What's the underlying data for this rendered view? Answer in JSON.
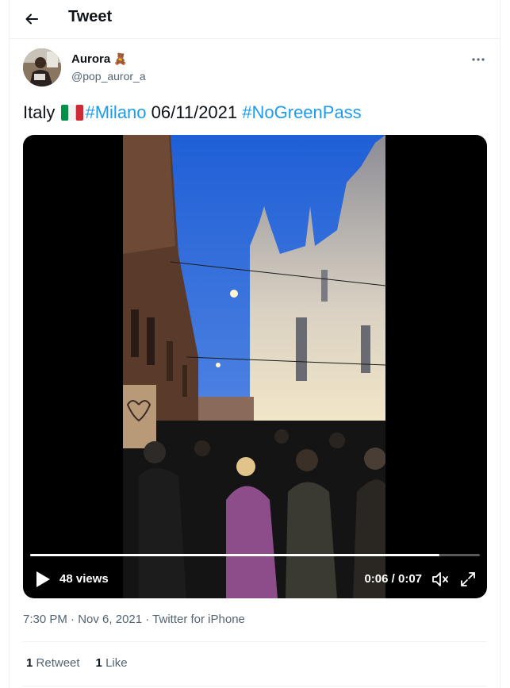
{
  "header": {
    "title": "Tweet"
  },
  "author": {
    "name": "Aurora",
    "emoji": "🧸",
    "handle": "@pop_auror_a"
  },
  "tweet": {
    "text_prefix": "Italy",
    "flag_icon": "italy-flag-icon",
    "hashtag_1": "#Milano",
    "date_text": "06/11/2021",
    "hashtag_2": "#NoGreenPass"
  },
  "video": {
    "views": "48 views",
    "timecode": "0:06 / 0:07",
    "progress": 0.91
  },
  "meta": {
    "time": "7:30 PM",
    "sep1": " · ",
    "date": "Nov 6, 2021",
    "sep2": " · ",
    "source": "Twitter for iPhone"
  },
  "stats": {
    "retweets_count": "1",
    "retweets_label": "Retweet",
    "likes_count": "1",
    "likes_label": "Like"
  },
  "colors": {
    "link": "#1d9bf0",
    "secondary_text": "#536471",
    "border": "#eff3f4"
  }
}
